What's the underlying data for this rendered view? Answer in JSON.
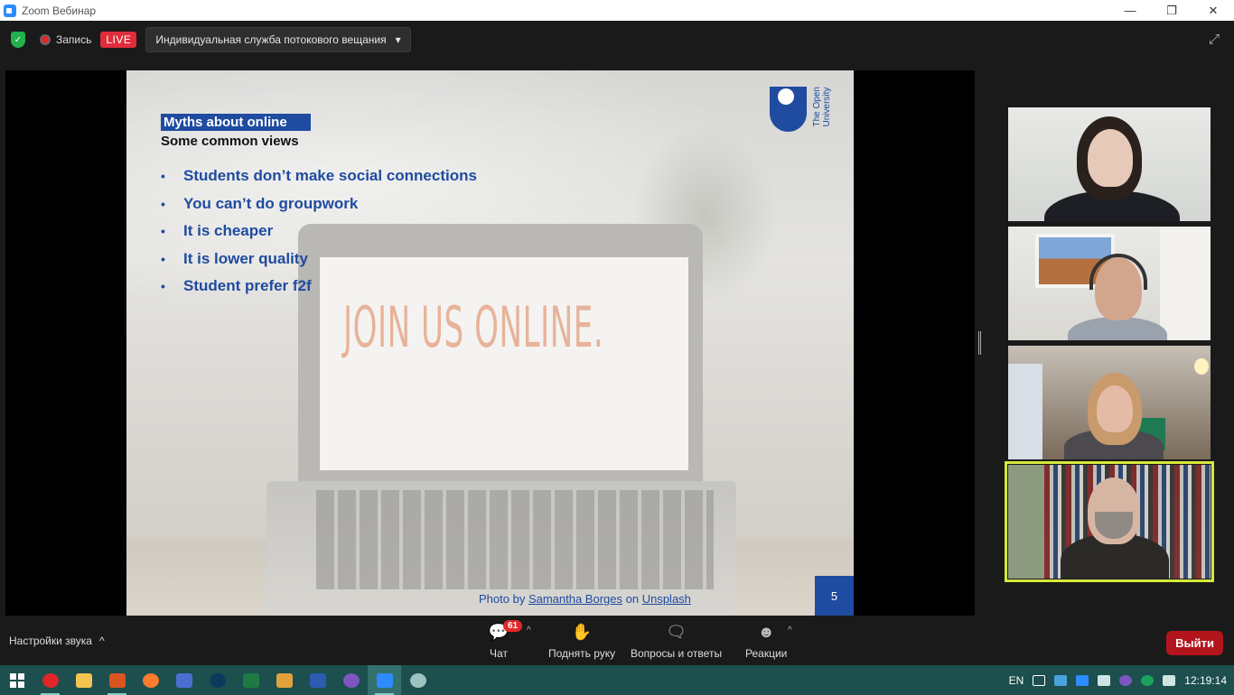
{
  "window": {
    "title": "Zoom Вебинар",
    "minimize": "—",
    "restore": "❐",
    "close": "✕"
  },
  "topbar": {
    "security_icon": "shield-check-icon",
    "record_label": "Запись",
    "live_label": "LIVE",
    "stream_label": "Индивидуальная служба потокового вещания",
    "stream_caret": "▾",
    "fullscreen_icon": "⤢"
  },
  "slide": {
    "tag": "Myths about online",
    "subtitle": "Some common views",
    "bullets": [
      "Students don’t make social connections",
      "You can’t do groupwork",
      "It is cheaper",
      "It is lower quality",
      "Student prefer f2f"
    ],
    "bullet_symbol": "•",
    "screen_text": "JOIN US ONLINE.",
    "logo_line1": "The Open",
    "logo_line2": "University",
    "credit_prefix": "Photo by ",
    "credit_author": "Samantha Borges",
    "credit_mid": " on ",
    "credit_site": "Unsplash",
    "page_number": "5"
  },
  "participants": [
    {
      "name": "participant-1"
    },
    {
      "name": "participant-2"
    },
    {
      "name": "participant-3"
    },
    {
      "name": "participant-4",
      "active_speaker": true
    }
  ],
  "bottombar": {
    "audio_settings": "Настройки звука",
    "audio_caret": "^",
    "chat_label": "Чат",
    "chat_badge": "61",
    "raise_hand_label": "Поднять руку",
    "qa_label": "Вопросы и ответы",
    "reactions_label": "Реакции",
    "leave_label": "Выйти",
    "caret": "^"
  },
  "taskbar": {
    "apps": [
      "windows-start",
      "opera",
      "file-explorer",
      "presentation",
      "firefox",
      "save-app",
      "webex",
      "excel",
      "key-app",
      "word",
      "viber",
      "zoom",
      "paint"
    ],
    "language": "EN",
    "clock": "12:19:14"
  },
  "colors": {
    "slide_blue": "#1f4ba0",
    "live_red": "#e02d3c",
    "leave_red": "#b3151c",
    "active_speaker": "#d6e83b",
    "taskbar": "#1c4f4e"
  }
}
